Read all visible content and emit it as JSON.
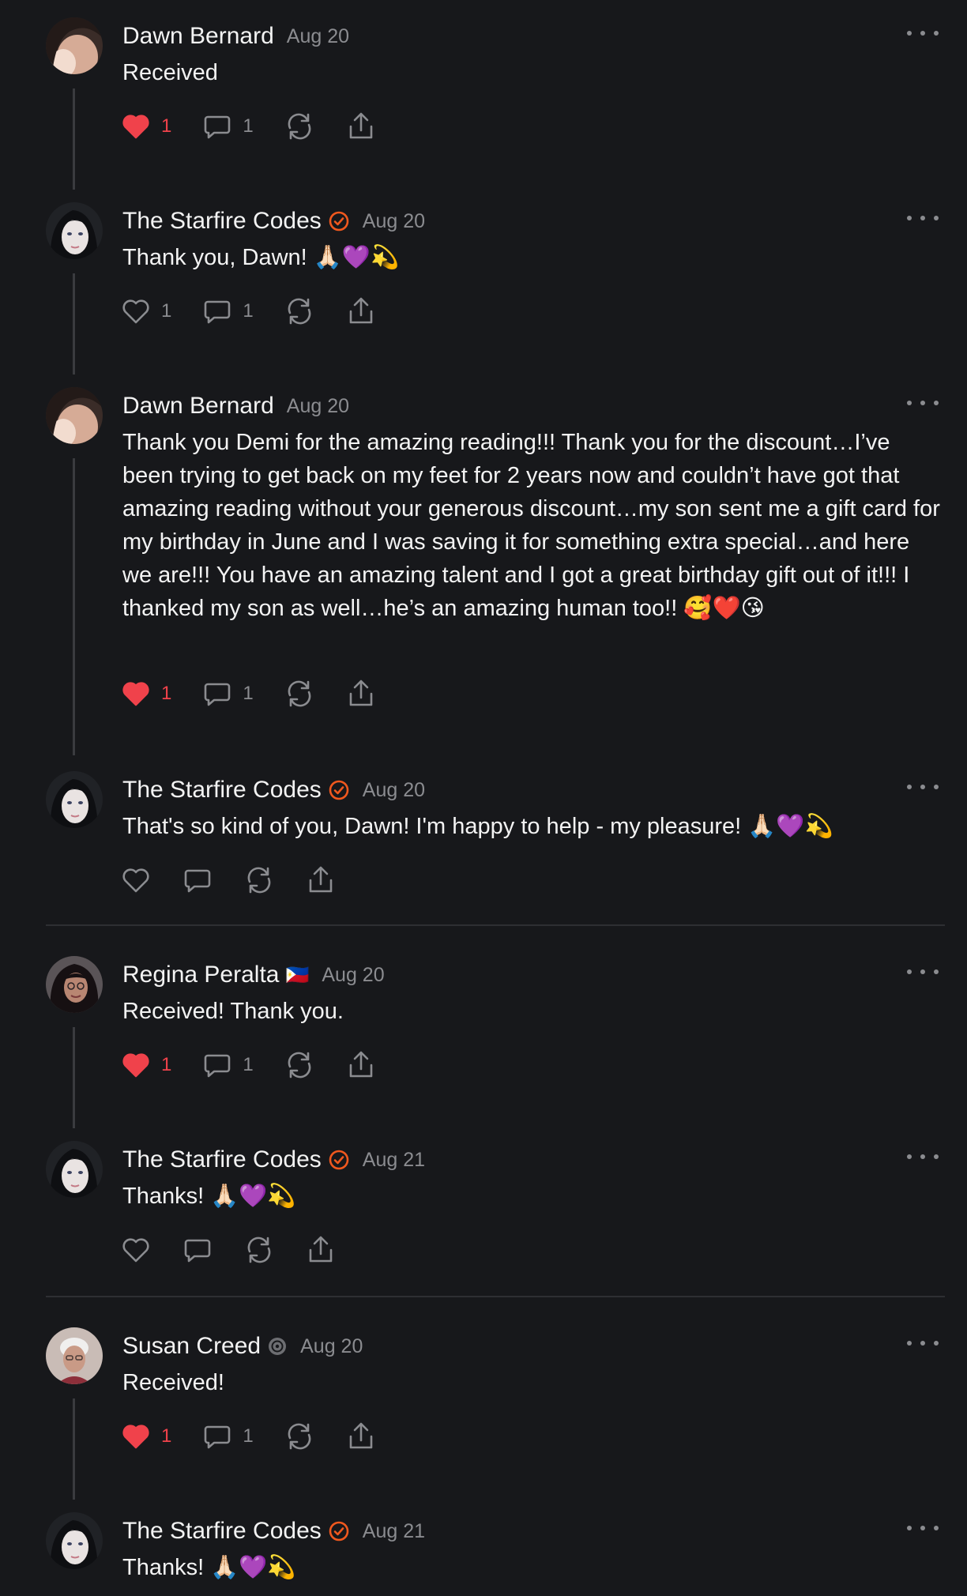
{
  "colors": {
    "background": "#17181b",
    "text": "#f3f3f3",
    "muted": "#8b8c90",
    "like_red": "#f0424b",
    "verified_orange": "#f0581e"
  },
  "posts": [
    {
      "author": "Dawn Bernard",
      "date": "Aug 20",
      "text": "Received",
      "likes": "1",
      "comments": "1"
    },
    {
      "author": "The Starfire Codes",
      "date": "Aug 20",
      "text": "Thank you, Dawn! 🙏🏻💜💫",
      "likes": "1",
      "comments": "1"
    },
    {
      "author": "Dawn Bernard",
      "date": "Aug 20",
      "text": "Thank you Demi for the amazing reading!!! Thank you for the discount…I’ve been trying to get back on my feet for 2 years now and couldn’t have got that amazing reading without your generous discount…my son sent me a gift card for my birthday in June and I was saving it for something extra special…and here we are!!! You have an amazing talent and I got a great birthday gift out of it!!! I thanked my son as well…he’s an amazing human too!! 🥰❤️😘",
      "likes": "1",
      "comments": "1"
    },
    {
      "author": "The Starfire Codes",
      "date": "Aug 20",
      "text": "That's so kind of you, Dawn! I'm happy to help - my pleasure! 🙏🏻💜💫"
    },
    {
      "author": "Regina Peralta",
      "flag": "🇵🇭",
      "date": "Aug 20",
      "text": "Received! Thank you.",
      "likes": "1",
      "comments": "1"
    },
    {
      "author": "The Starfire Codes",
      "date": "Aug 21",
      "text": "Thanks! 🙏🏻💜💫"
    },
    {
      "author": "Susan Creed",
      "date": "Aug 20",
      "text": "Received!",
      "likes": "1",
      "comments": "1"
    },
    {
      "author": "The Starfire Codes",
      "date": "Aug 21",
      "text": "Thanks! 🙏🏻💜💫"
    }
  ]
}
